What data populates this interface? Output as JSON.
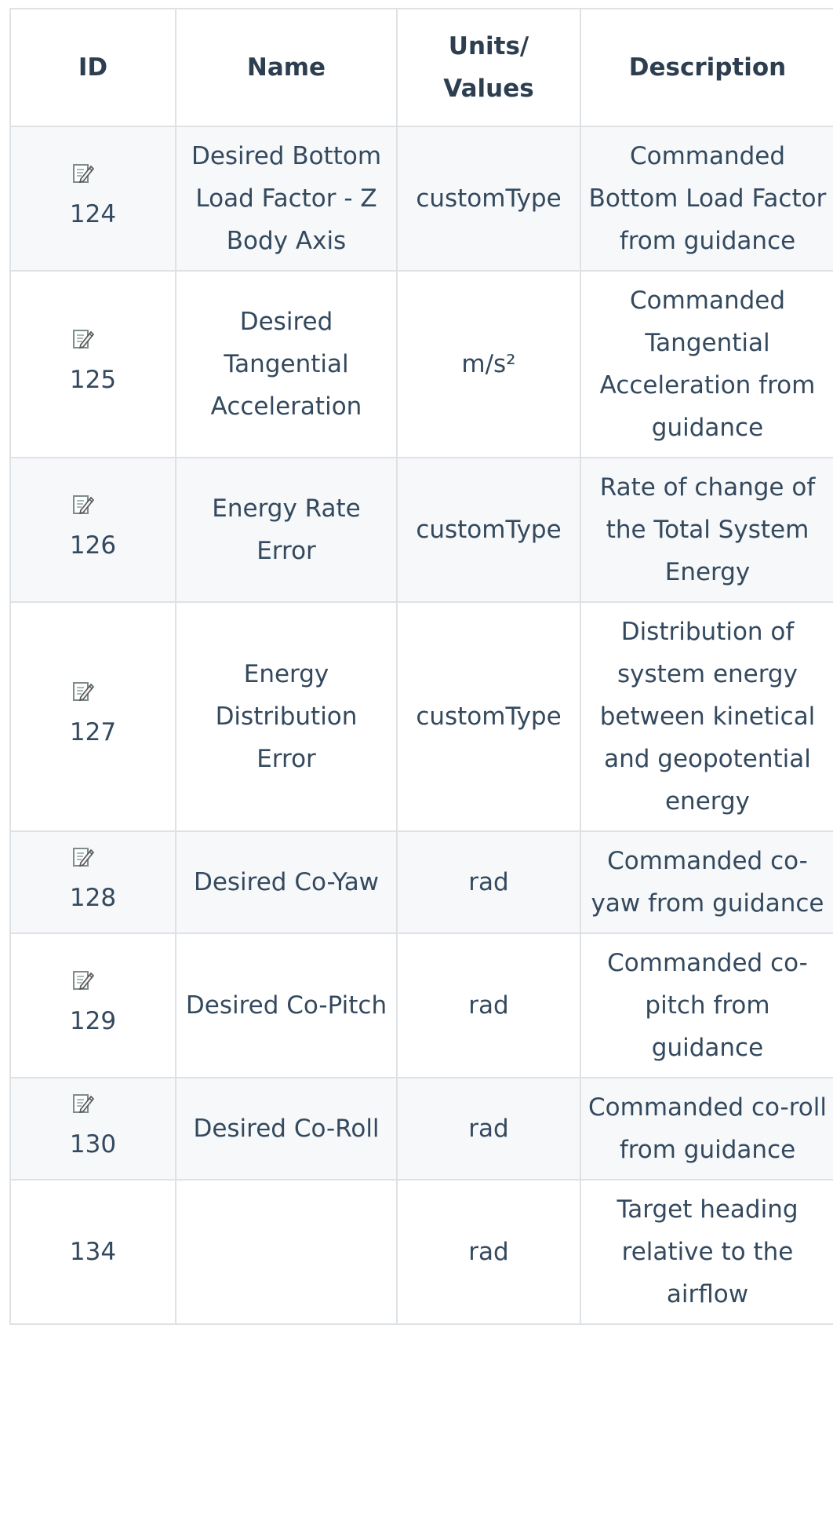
{
  "table": {
    "headers": {
      "id": "ID",
      "name": "Name",
      "units": "Units/ Values",
      "description": "Description"
    },
    "rows": [
      {
        "id": "124",
        "has_edit_icon": true,
        "name": "Desired Bottom Load Factor - Z Body Axis",
        "units": "customType",
        "description": "Commanded Bottom Load Factor from guidance"
      },
      {
        "id": "125",
        "has_edit_icon": true,
        "name": "Desired Tangential Acceleration",
        "units": "m/s²",
        "description": "Commanded Tangential Acceleration from guidance"
      },
      {
        "id": "126",
        "has_edit_icon": true,
        "name": "Energy Rate Error",
        "units": "customType",
        "description": "Rate of change of the Total System Energy"
      },
      {
        "id": "127",
        "has_edit_icon": true,
        "name": "Energy Distribution Error",
        "units": "customType",
        "description": "Distribution of system energy between kinetical and geopotential energy"
      },
      {
        "id": "128",
        "has_edit_icon": true,
        "name": "Desired Co-Yaw",
        "units": "rad",
        "description": "Commanded co-yaw from guidance"
      },
      {
        "id": "129",
        "has_edit_icon": true,
        "name": "Desired Co-Pitch",
        "units": "rad",
        "description": "Commanded co-pitch from guidance"
      },
      {
        "id": "130",
        "has_edit_icon": true,
        "name": "Desired Co-Roll",
        "units": "rad",
        "description": "Commanded co-roll from guidance"
      },
      {
        "id": "134",
        "has_edit_icon": false,
        "name": "",
        "units": "rad",
        "description": "Target heading relative to the airflow"
      }
    ],
    "icons": {
      "edit": "edit-icon"
    }
  }
}
